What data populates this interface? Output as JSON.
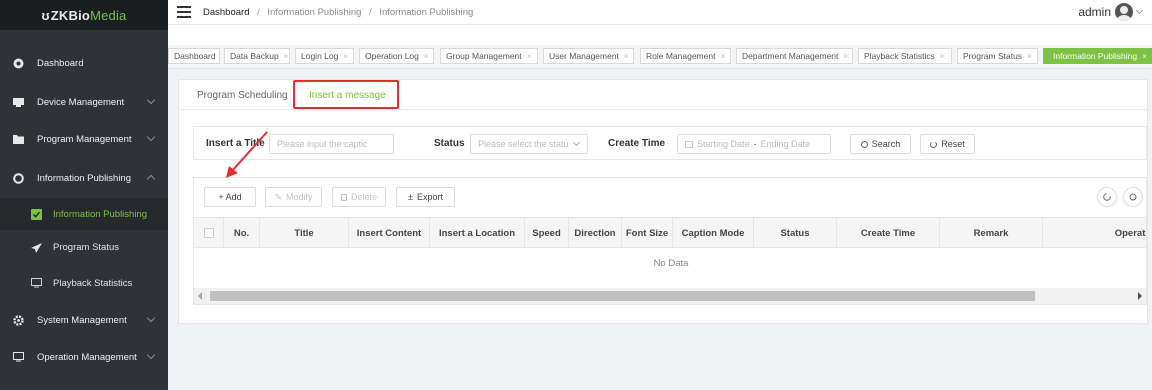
{
  "app": {
    "logo_part1": "ZKBio",
    "logo_part2": "Media"
  },
  "sidebar": {
    "items": [
      {
        "label": "Dashboard",
        "icon": "dashboard-icon"
      },
      {
        "label": "Device Management",
        "icon": "device-icon"
      },
      {
        "label": "Program Management",
        "icon": "folder-icon"
      },
      {
        "label": "Information Publishing",
        "icon": "publish-icon"
      },
      {
        "label": "Information Publishing",
        "icon": "check-square-icon",
        "active": true
      },
      {
        "label": "Program Status",
        "icon": "send-icon"
      },
      {
        "label": "Playback Statistics",
        "icon": "monitor-icon"
      },
      {
        "label": "System Management",
        "icon": "gear-icon"
      },
      {
        "label": "Operation Management",
        "icon": "monitor-icon"
      }
    ]
  },
  "header": {
    "crumb0": "Dashboard",
    "crumb1": "Information Publishing",
    "crumb2": "Information Publishing",
    "separator": "/",
    "user": "admin"
  },
  "tabs": [
    {
      "label": "Dashboard"
    },
    {
      "label": "Data Backup"
    },
    {
      "label": "Login Log"
    },
    {
      "label": "Operation Log"
    },
    {
      "label": "Group Management"
    },
    {
      "label": "User Management"
    },
    {
      "label": "Role Management"
    },
    {
      "label": "Department Management"
    },
    {
      "label": "Playback Statistics"
    },
    {
      "label": "Program Status"
    },
    {
      "label": "Information Publishing",
      "active": true
    }
  ],
  "tab_close": "×",
  "subtabs": {
    "scheduling": "Program Scheduling",
    "insert": "Insert a message"
  },
  "filter": {
    "title_label": "Insert a Title",
    "title_placeholder": "Please input the captic",
    "status_label": "Status",
    "status_placeholder": "Please select the statu",
    "time_label": "Create Time",
    "start_placeholder": "Starting Date",
    "range_sep": "-",
    "end_placeholder": "Ending Date",
    "search": "Search",
    "reset": "Reset"
  },
  "toolbar": {
    "add": "+ Add",
    "modify": "Modify",
    "delete": "Delete",
    "export": "Export"
  },
  "table": {
    "columns": [
      "No.",
      "Title",
      "Insert Content",
      "Insert a Location",
      "Speed",
      "Direction",
      "Font Size",
      "Caption Mode",
      "Status",
      "Create Time",
      "Remark",
      "Operati"
    ],
    "empty": "No Data"
  },
  "colors": {
    "accent": "#7dc242",
    "sidebar": "#2f3337",
    "highlight": "#e52d2d"
  }
}
